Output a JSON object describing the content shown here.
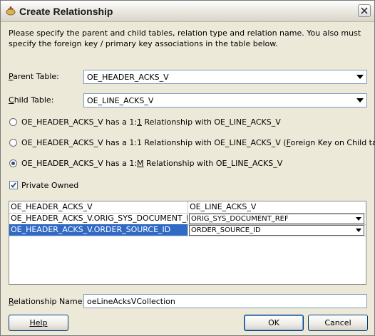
{
  "window": {
    "title": "Create Relationship"
  },
  "instructions": "Please specify the parent and child tables, relation type and relation name.  You also must specify the foreign key / primary key associations in the table below.",
  "parent_table": {
    "label_pre": "",
    "label_key": "P",
    "label_post": "arent Table:",
    "value": "OE_HEADER_ACKS_V"
  },
  "child_table": {
    "label_pre": "",
    "label_key": "C",
    "label_post": "hild Table:",
    "value": "OE_LINE_ACKS_V"
  },
  "relationship_options": [
    {
      "pre": "OE_HEADER_ACKS_V has a 1:",
      "key": "1",
      "post": " Relationship with OE_LINE_ACKS_V",
      "post2": "",
      "key2": "",
      "post3": "",
      "selected": false
    },
    {
      "pre": "OE_HEADER_ACKS_V has a 1:1 Relationship with OE_LINE_ACKS_V (",
      "key": "F",
      "post": "oreign Key on Child table)",
      "selected": false
    },
    {
      "pre": "OE_HEADER_ACKS_V has a 1:",
      "key": "M",
      "post": " Relationship with OE_LINE_ACKS_V",
      "selected": true
    }
  ],
  "private_owned": {
    "label": "Private Owned",
    "checked": true
  },
  "key_table": {
    "header": [
      "OE_HEADER_ACKS_V",
      "OE_LINE_ACKS_V"
    ],
    "rows": [
      {
        "parent": "OE_HEADER_ACKS_V.ORIG_SYS_DOCUMENT_REF",
        "child": "ORIG_SYS_DOCUMENT_REF",
        "selected": false
      },
      {
        "parent": "OE_HEADER_ACKS_V.ORDER_SOURCE_ID",
        "child": "ORDER_SOURCE_ID",
        "selected": true
      }
    ]
  },
  "relationship_name": {
    "label_pre": "",
    "label_key": "R",
    "label_post": "elationship Name:",
    "value": "oeLineAcksVCollection"
  },
  "buttons": {
    "help": "Help",
    "ok": "OK",
    "cancel": "Cancel"
  }
}
